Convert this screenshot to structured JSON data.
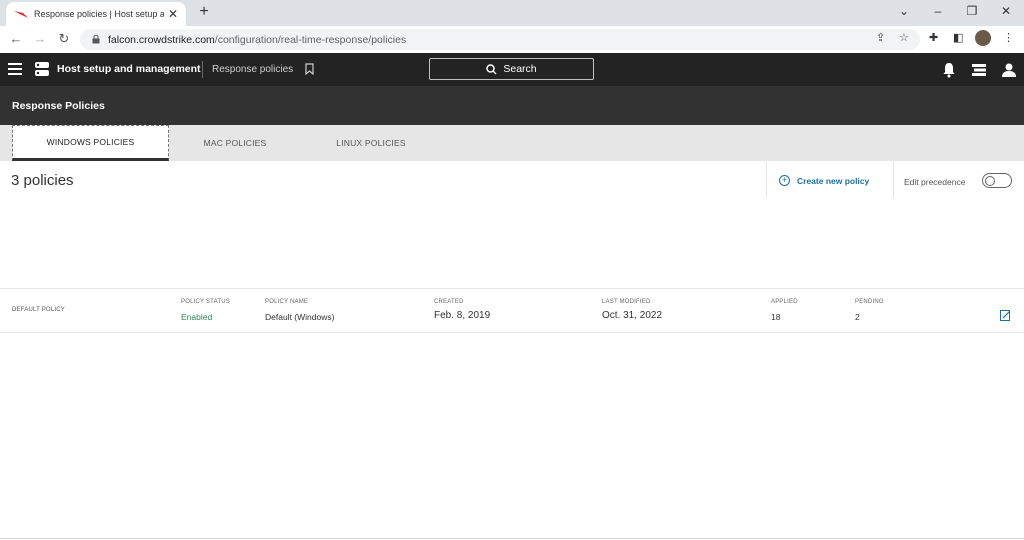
{
  "browser": {
    "tab_title": "Response policies | Host setup ar",
    "url_host": "falcon.crowdstrike.com",
    "url_path": "/configuration/real-time-response/policies"
  },
  "header": {
    "app_name": "Host setup and management",
    "breadcrumb": "Response policies",
    "search_label": "Search"
  },
  "page": {
    "title": "Response Policies",
    "tabs": [
      {
        "label": "WINDOWS POLICIES",
        "active": true
      },
      {
        "label": "MAC POLICIES",
        "active": false
      },
      {
        "label": "LINUX POLICIES",
        "active": false
      }
    ],
    "policy_count": "3 policies",
    "create_label": "Create new policy",
    "edit_precedence_label": "Edit precedence"
  },
  "policy_row": {
    "group_label": "DEFAULT POLICY",
    "columns": {
      "status": {
        "label": "POLICY STATUS",
        "value": "Enabled"
      },
      "name": {
        "label": "POLICY NAME",
        "value": "Default (Windows)"
      },
      "created": {
        "label": "CREATED",
        "value": "Feb. 8, 2019"
      },
      "modified": {
        "label": "LAST MODIFIED",
        "value": "Oct. 31, 2022"
      },
      "applied": {
        "label": "APPLIED",
        "value": "18"
      },
      "pending": {
        "label": "PENDING",
        "value": "2"
      }
    }
  },
  "colors": {
    "appbar": "#232323",
    "subheader": "#323232",
    "link": "#1b6ea8",
    "enabled": "#2e8b57"
  }
}
